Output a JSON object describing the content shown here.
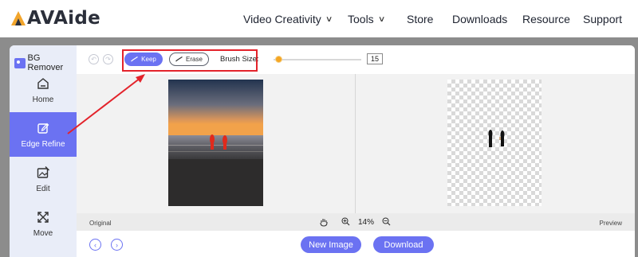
{
  "site": {
    "brand": "AVAide",
    "nav": [
      {
        "label": "Video Creativity",
        "dropdown": true
      },
      {
        "label": "Tools",
        "dropdown": true
      },
      {
        "label": "Store",
        "dropdown": false
      },
      {
        "label": "Downloads",
        "dropdown": false
      },
      {
        "label": "Resource",
        "dropdown": false
      },
      {
        "label": "Support",
        "dropdown": false
      }
    ]
  },
  "sidebar": {
    "app_title": "BG Remover",
    "items": [
      {
        "label": "Home",
        "icon": "home-icon",
        "active": false
      },
      {
        "label": "Edge Refine",
        "icon": "edit-square-icon",
        "active": true
      },
      {
        "label": "Edit",
        "icon": "image-edit-icon",
        "active": false
      },
      {
        "label": "Move",
        "icon": "move-arrows-icon",
        "active": false
      }
    ]
  },
  "toolbar": {
    "keep_label": "Keep",
    "erase_label": "Erase",
    "brush_label": "Brush Size:",
    "brush_size": "15",
    "brush_level": 0.05
  },
  "status": {
    "original_label": "Original",
    "preview_label": "Preview",
    "zoom": "14%"
  },
  "bottom": {
    "new_image_label": "New Image",
    "download_label": "Download"
  },
  "colors": {
    "accent": "#6b72f2",
    "highlight_box": "#e3232b",
    "slider_thumb": "#f5a623"
  }
}
